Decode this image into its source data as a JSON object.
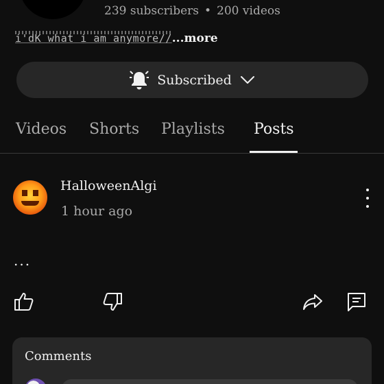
{
  "channel": {
    "subscribers": "239 subscribers",
    "separator": "•",
    "videos": "200 videos",
    "description": "i'dK what i am anymore//",
    "more": "...more"
  },
  "subscribe_button": {
    "label": "Subscribed",
    "icon": "bell-icon",
    "chevron": "chevron-down-icon"
  },
  "tabs": [
    {
      "label": "Videos"
    },
    {
      "label": "Shorts"
    },
    {
      "label": "Playlists"
    },
    {
      "label": "Posts",
      "active": true
    }
  ],
  "post": {
    "author": "HalloweenAlgi",
    "time": "1 hour ago",
    "text": "...",
    "actions": [
      "like-icon",
      "dislike-icon",
      "share-icon",
      "comment-icon"
    ]
  },
  "comments": {
    "title": "Comments"
  },
  "colors": {
    "background": "#0f0f0f",
    "surface": "#272727",
    "text": "#f1f1f1",
    "muted": "#aaaaaa"
  }
}
